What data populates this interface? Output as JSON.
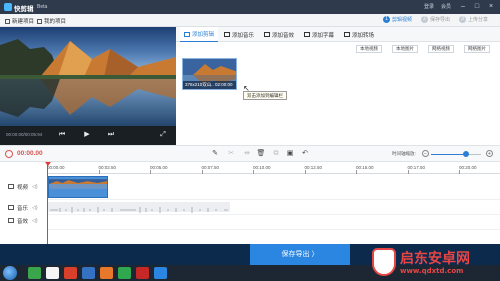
{
  "titlebar": {
    "app_name": "快剪辑",
    "beta": "Beta",
    "login": "登录",
    "vip": "会员"
  },
  "menubar": {
    "new_project": "新建项目",
    "open_project": "我的项目",
    "steps": [
      {
        "num": "1",
        "label": "剪辑视频"
      },
      {
        "num": "2",
        "label": "保存导出"
      },
      {
        "num": "3",
        "label": "上传分享"
      }
    ]
  },
  "preview": {
    "time": "00:00:00/00:05:94"
  },
  "tabs": [
    {
      "label": "添加剪辑"
    },
    {
      "label": "添加音乐"
    },
    {
      "label": "添加音效"
    },
    {
      "label": "添加字幕"
    },
    {
      "label": "添加转场"
    }
  ],
  "add_buttons": [
    {
      "label": "本地视频"
    },
    {
      "label": "本地图片"
    },
    {
      "label": "网络视频"
    },
    {
      "label": "网络图片"
    }
  ],
  "media": {
    "thumb_caption": "376x210双山.. 02:00:00",
    "tooltip": "双击添加到编辑栏"
  },
  "toolbar": {
    "current_time": "00:00.00",
    "zoom_label": "时间轴缩放:",
    "zoom_level": 0.7
  },
  "timeline": {
    "ticks": [
      "00:00.00",
      "00:02.50",
      "00:05.00",
      "00:07.50",
      "00:10.00",
      "00:12.50",
      "00:15.00",
      "00:17.50",
      "00:20.00"
    ],
    "tracks": [
      {
        "label": "视频"
      },
      {
        "label": "音乐"
      },
      {
        "label": "音效"
      }
    ]
  },
  "bottom": {
    "save_label": "保存导出 〉"
  },
  "watermark": {
    "title": "启东安卓网",
    "url": "www.qdxtd.com"
  },
  "colors": {
    "accent": "#2a86e0",
    "playhead": "#e03a3a",
    "titlebar": "#2f3b4c",
    "bottombar": "#0c2a4c"
  }
}
